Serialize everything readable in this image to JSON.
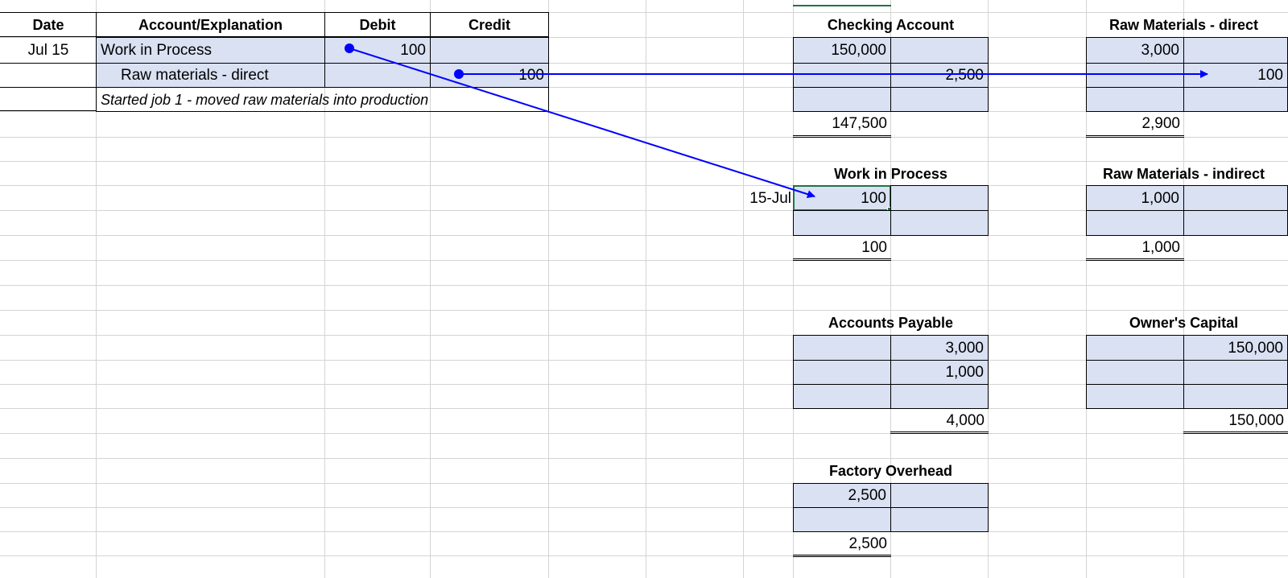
{
  "journal": {
    "headers": {
      "date": "Date",
      "account": "Account/Explanation",
      "debit": "Debit",
      "credit": "Credit"
    },
    "entry": {
      "date": "Jul 15",
      "debit_account": "Work in Process",
      "debit_amount": "100",
      "credit_account": "Raw materials - direct",
      "credit_amount": "100",
      "explanation": "Started job 1 - moved raw materials into production"
    }
  },
  "t_accounts": {
    "checking": {
      "title": "Checking Account",
      "debits": [
        "150,000"
      ],
      "credits": [
        "",
        "2,500"
      ],
      "balance": "147,500"
    },
    "raw_direct": {
      "title": "Raw Materials - direct",
      "debits": [
        "3,000"
      ],
      "credits": [
        "",
        "100"
      ],
      "balance": "2,900"
    },
    "wip": {
      "title": "Work in Process",
      "date_label": "15-Jul",
      "debits": [
        "100"
      ],
      "balance": "100"
    },
    "raw_indirect": {
      "title": "Raw Materials - indirect",
      "debits": [
        "1,000"
      ],
      "balance": "1,000"
    },
    "ap": {
      "title": "Accounts Payable",
      "credits": [
        "3,000",
        "1,000"
      ],
      "balance": "4,000"
    },
    "owners_capital": {
      "title": "Owner's Capital",
      "credits": [
        "150,000"
      ],
      "balance": "150,000"
    },
    "factory_overhead": {
      "title": "Factory Overhead",
      "debits": [
        "2,500"
      ],
      "balance": "2,500"
    }
  },
  "colors": {
    "cell_fill": "#d9e1f2",
    "arrow": "#0000ff",
    "selection": "#217346",
    "gridline": "#d4d4d4"
  },
  "arrows": [
    {
      "from": "journal.entry.debit_amount",
      "to": "t_accounts.wip.debits.0"
    },
    {
      "from": "journal.entry.credit_amount",
      "to": "t_accounts.raw_direct.credits.1"
    }
  ]
}
